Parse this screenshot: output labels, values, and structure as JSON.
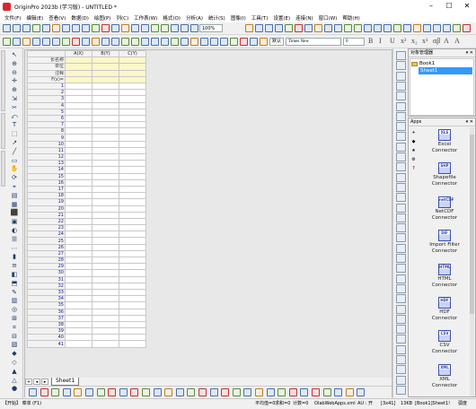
{
  "window": {
    "title": "OriginPro 2023b (学习版) - UNTITLED *",
    "minimize": "–",
    "maximize": "☐",
    "close": "✕"
  },
  "menu": [
    "文件(F)",
    "编辑(E)",
    "查看(V)",
    "数据(D)",
    "绘图(P)",
    "列(C)",
    "工作表(W)",
    "格式(O)",
    "分析(A)",
    "统计(S)",
    "图像(I)",
    "工具(T)",
    "设置(E)",
    "连接(N)",
    "窗口(W)",
    "帮助(H)"
  ],
  "toolbar": {
    "zoom": "100%",
    "font_size_default": "默认",
    "font_name": "Times New",
    "font_size": "0",
    "format_buttons": [
      "B",
      "I",
      "U",
      "x²",
      "x₂",
      "x¹",
      "αβ",
      "A",
      "A"
    ]
  },
  "sheet": {
    "columns": [
      "A(X)",
      "B(Y)",
      "C(Y)"
    ],
    "meta_rows": [
      "长名称",
      "单位",
      "注释",
      "F(x)="
    ],
    "rows": [
      "1",
      "2",
      "3",
      "4",
      "5",
      "6",
      "7",
      "8",
      "9",
      "10",
      "11",
      "12",
      "13",
      "14",
      "15",
      "16",
      "17",
      "18",
      "19",
      "20",
      "21",
      "22",
      "23",
      "24",
      "25",
      "26",
      "27",
      "28",
      "29",
      "30",
      "31",
      "32",
      "33",
      "34",
      "35",
      "36",
      "37",
      "38",
      "39",
      "40",
      "41"
    ],
    "tab": "Sheet1",
    "nav": [
      "+",
      "◂",
      "▸"
    ]
  },
  "object_manager": {
    "title": "对象管理器",
    "items": [
      {
        "label": "Book1",
        "selected": false
      },
      {
        "label": "Sheet1",
        "selected": true
      }
    ],
    "buttons": "▾ ✕"
  },
  "apps": {
    "title": "Apps",
    "buttons": "▾ ✕",
    "items": [
      {
        "icon_text": "XLS",
        "label1": "Excel",
        "label2": "Connector"
      },
      {
        "icon_text": "SHP",
        "label1": "Shapefile",
        "label2": "Connector"
      },
      {
        "icon_text": "netCDF",
        "label1": "NetCDF",
        "label2": "Connector"
      },
      {
        "icon_text": "DIF",
        "label1": "Import Filter",
        "label2": "Connector"
      },
      {
        "icon_text": "HTML",
        "label1": "HTML",
        "label2": "Connector"
      },
      {
        "icon_text": "HDF",
        "label1": "HDF",
        "label2": "Connector"
      },
      {
        "icon_text": "CSV",
        "label1": "CSV",
        "label2": "Connector"
      },
      {
        "icon_text": "XML",
        "label1": "XML",
        "label2": "Connector"
      }
    ],
    "side_buttons": [
      "+",
      "◆",
      "★",
      "⚙",
      "?"
    ]
  },
  "status": {
    "start": "【开始】 菜单 (F1)",
    "mean": "平均值=0",
    "sum": "求和=0",
    "count": "计数=0",
    "file": "OlabWebApps.xml",
    "au": "AU : 开",
    "dims": "[3x41]",
    "size": "13KB",
    "active": "[Book1]Sheet1!",
    "rad": "弧度"
  },
  "colors": {
    "meta_row_bg": "#fbf7c8",
    "selection": "#3399ff",
    "app_icon": "#3a4fae",
    "logo": "#d9262b"
  }
}
